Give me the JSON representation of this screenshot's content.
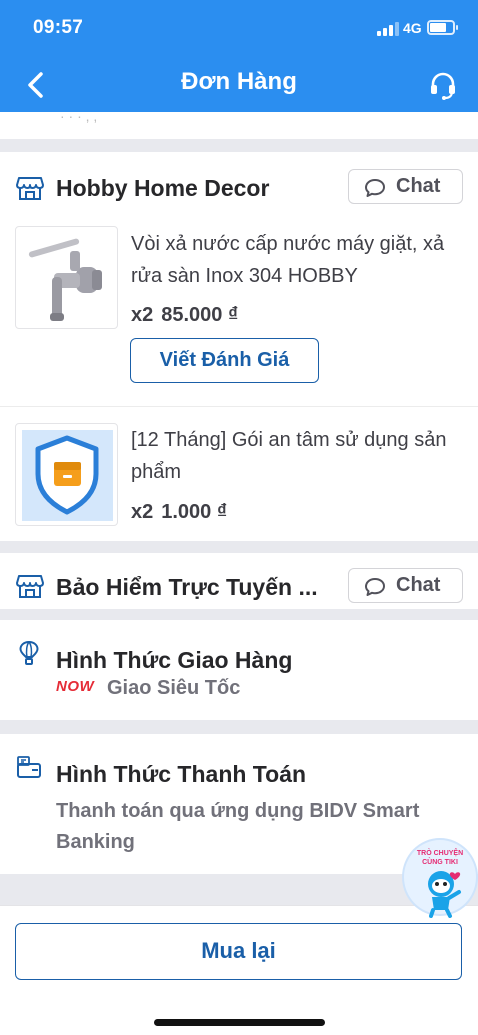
{
  "status_bar": {
    "time": "09:57",
    "network": "4G"
  },
  "header": {
    "title": "Đơn Hàng",
    "back_icon": "chevron-left-icon",
    "support_icon": "headset-icon"
  },
  "shops": [
    {
      "name": "Hobby Home Decor",
      "chat_label": "Chat",
      "products": [
        {
          "name": "Vòi xả nước cấp nước máy giặt, xả rửa sàn Inox 304 HOBBY",
          "quantity": "x2",
          "price": "85.000 ₫",
          "review_label": "Viết Đánh Giá"
        },
        {
          "name": "[12 Tháng] Gói an tâm sử dụng sản phẩm",
          "quantity": "x2",
          "price": "1.000 ₫"
        }
      ]
    },
    {
      "name": "Bảo Hiểm Trực Tuyến ...",
      "chat_label": "Chat"
    }
  ],
  "delivery": {
    "title": "Hình Thức Giao Hàng",
    "badge": "NOW",
    "method": "Giao Siêu Tốc"
  },
  "payment": {
    "title": "Hình Thức Thanh Toán",
    "method": "Thanh toán qua ứng dụng BIDV Smart Banking"
  },
  "chatbot": {
    "line1": "TRÒ CHUYỆN",
    "line2": "CÙNG TIKI"
  },
  "footer": {
    "rebuy_label": "Mua lại"
  },
  "colors": {
    "header_blue": "#2b8ef0",
    "link_blue": "#1a5fa8",
    "now_red": "#e52c37",
    "background": "#e8e9ee"
  }
}
